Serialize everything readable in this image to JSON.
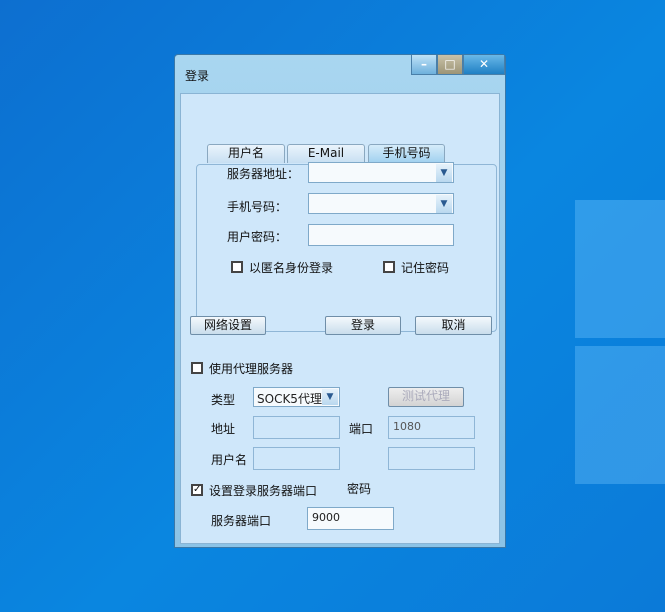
{
  "window": {
    "title": "登录",
    "minimize": "–",
    "restore": "□",
    "close": "✕"
  },
  "tabs": [
    {
      "label": "用户名"
    },
    {
      "label": "E-Mail"
    },
    {
      "label": "手机号码"
    }
  ],
  "form": {
    "server_label": "服务器地址：",
    "server_value": "",
    "phone_label": "手机号码：",
    "phone_value": "",
    "password_label": "用户密码：",
    "password_value": "",
    "anonymous_label": "以匿名身份登录",
    "anonymous_checked": false,
    "remember_label": "记住密码",
    "remember_checked": false
  },
  "buttons": {
    "network": "网络设置",
    "login": "登录",
    "cancel": "取消",
    "test_proxy": "测试代理"
  },
  "proxy": {
    "use_label": "使用代理服务器",
    "use_checked": false,
    "type_label": "类型",
    "type_value": "SOCK5代理",
    "address_label": "地址",
    "address_value": "",
    "port_label": "端口",
    "port_value": "1080",
    "username_label": "用户名",
    "username_value": "",
    "password_label": "密码",
    "password_value": ""
  },
  "server_port": {
    "set_label": "设置登录服务器端口",
    "set_checked": true,
    "port_label": "服务器端口",
    "port_value": "9000"
  }
}
